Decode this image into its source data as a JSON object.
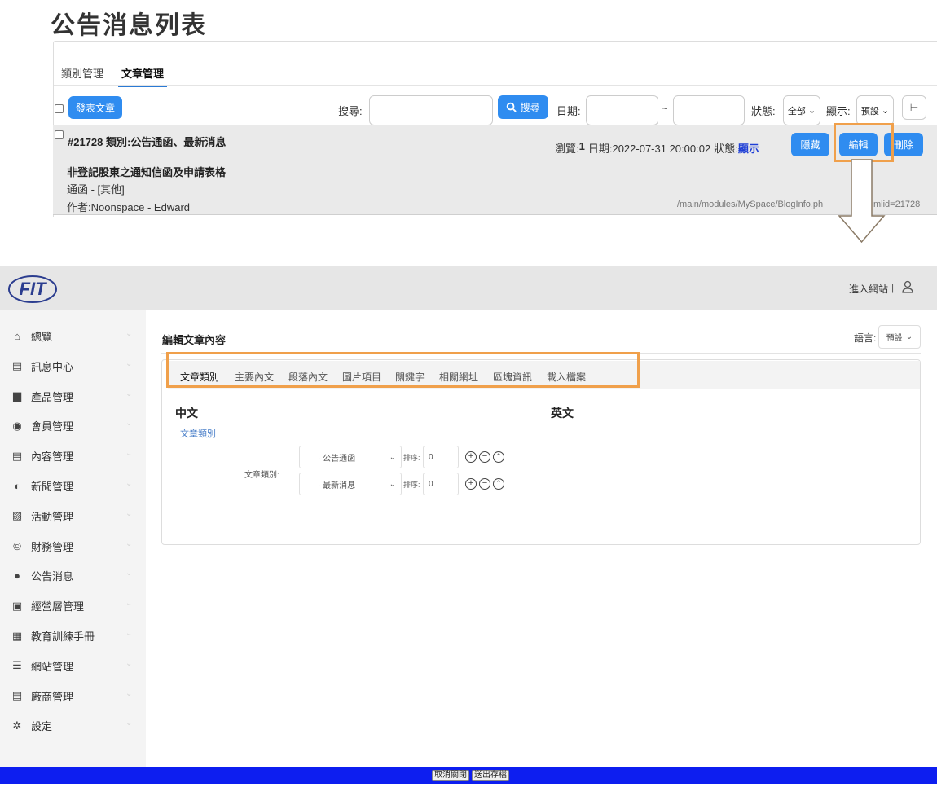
{
  "top": {
    "page_title": "公告消息列表",
    "tabs": [
      {
        "label": "類別管理"
      },
      {
        "label": "文章管理"
      }
    ],
    "publish_btn": "發表文章",
    "search_label": "搜尋:",
    "search_btn": "搜尋",
    "date_label": "日期:",
    "date_sep": "~",
    "status_label": "狀態:",
    "status_value": "全部",
    "display_label": "顯示:",
    "display_value": "預設",
    "article": {
      "id_category": "#21728 類別:公告通函、最新消息",
      "views_prefix": "瀏覽:",
      "views": "1",
      "date_text": "日期:2022-07-31 20:00:02",
      "status_prefix": "狀態:",
      "status_value": "顯示",
      "btn_hide": "隱藏",
      "btn_edit": "編輯",
      "btn_delete": "刪除",
      "title": "非登記股東之通知信函及申請表格",
      "type": "通函 - [其他]",
      "author": "作者:Noonspace - Edward",
      "url_left": "/main/modules/MySpace/BlogInfo.ph",
      "url_right": "mlid=21728"
    }
  },
  "admin": {
    "logo": "FIT",
    "header_link": "進入網站",
    "header_sep": "|",
    "sidebar": [
      {
        "label": "總覽",
        "icon": "home-icon",
        "glyph": "⌂"
      },
      {
        "label": "訊息中心",
        "icon": "message-icon",
        "glyph": "▤"
      },
      {
        "label": "產品管理",
        "icon": "bag-icon",
        "glyph": "▆"
      },
      {
        "label": "會員管理",
        "icon": "member-icon",
        "glyph": "◉"
      },
      {
        "label": "內容管理",
        "icon": "content-icon",
        "glyph": "▤"
      },
      {
        "label": "新聞管理",
        "icon": "news-icon",
        "glyph": "◐"
      },
      {
        "label": "活動管理",
        "icon": "event-icon",
        "glyph": "▨"
      },
      {
        "label": "財務管理",
        "icon": "finance-icon",
        "glyph": "©"
      },
      {
        "label": "公告消息",
        "icon": "info-icon",
        "glyph": "●"
      },
      {
        "label": "經營層管理",
        "icon": "management-icon",
        "glyph": "▣"
      },
      {
        "label": "教育訓練手冊",
        "icon": "manual-icon",
        "glyph": "▦"
      },
      {
        "label": "網站管理",
        "icon": "website-icon",
        "glyph": "☰"
      },
      {
        "label": "廠商管理",
        "icon": "vendor-icon",
        "glyph": "▤"
      },
      {
        "label": "設定",
        "icon": "settings-icon",
        "glyph": "✲"
      }
    ],
    "edit_title": "編輯文章內容",
    "lang_label": "語言:",
    "lang_value": "預設",
    "inner_tabs": [
      {
        "label": "文章類別"
      },
      {
        "label": "主要內文"
      },
      {
        "label": "段落內文"
      },
      {
        "label": "圖片項目"
      },
      {
        "label": "關鍵字"
      },
      {
        "label": "相關網址"
      },
      {
        "label": "區塊資訊"
      },
      {
        "label": "載入檔案"
      }
    ],
    "col_zh": "中文",
    "col_en": "英文",
    "category_link": "文章類別",
    "category_field_label": "文章類別:",
    "category_rows": [
      {
        "value": "· 公告通函",
        "sort_label": "排序:",
        "sort_value": "0"
      },
      {
        "value": "· 最新消息",
        "sort_label": "排序:",
        "sort_value": "0"
      }
    ],
    "footer_cancel": "取消關閉",
    "footer_submit": "送出存檔"
  },
  "colors": {
    "accent": "#2f8cf0",
    "highlight": "#f0a04b",
    "footer": "#0d1ef0",
    "link": "#1f3fd6"
  }
}
